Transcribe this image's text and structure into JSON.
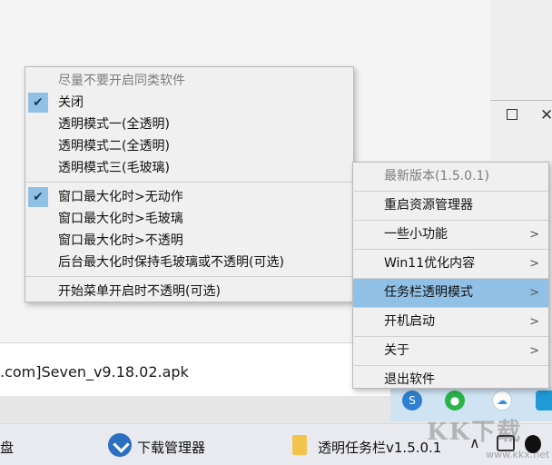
{
  "background": {
    "file_name": ".com]Seven_v9.18.02.apk"
  },
  "taskbar": {
    "left_label": "盘",
    "download_manager": "下载管理器",
    "transparent_taskbar": "透明任务栏v1.5.0.1"
  },
  "watermark": {
    "main": "KK下载",
    "sub": "www.kkx.net"
  },
  "main_menu": {
    "items": [
      {
        "label": "最新版本(1.5.0.1)",
        "disabled": true,
        "submenu": false
      },
      {
        "label": "重启资源管理器",
        "submenu": false
      },
      {
        "label": "一些小功能",
        "submenu": true
      },
      {
        "label": "Win11优化内容",
        "submenu": true
      },
      {
        "label": "任务栏透明模式",
        "submenu": true,
        "active": true
      },
      {
        "label": "开机启动",
        "submenu": true
      },
      {
        "label": "关于",
        "submenu": true
      },
      {
        "label": "退出软件",
        "submenu": false
      }
    ]
  },
  "sub_menu": {
    "header": "尽量不要开启同类软件",
    "items_group1": [
      {
        "label": "关闭",
        "checked": true
      },
      {
        "label": "透明模式一(全透明)",
        "checked": false
      },
      {
        "label": "透明模式二(全透明)",
        "checked": false
      },
      {
        "label": "透明模式三(毛玻璃)",
        "checked": false
      }
    ],
    "items_group2": [
      {
        "label": "窗口最大化时>无动作",
        "checked": true
      },
      {
        "label": "窗口最大化时>毛玻璃",
        "checked": false
      },
      {
        "label": "窗口最大化时>不透明",
        "checked": false
      },
      {
        "label": "后台最大化时保持毛玻璃或不透明(可选)",
        "checked": false
      }
    ],
    "items_group3": [
      {
        "label": "开始菜单开启时不透明(可选)",
        "checked": false
      }
    ]
  },
  "colors": {
    "highlight": "#91c0e6",
    "menu_bg": "#f0f0f0"
  }
}
